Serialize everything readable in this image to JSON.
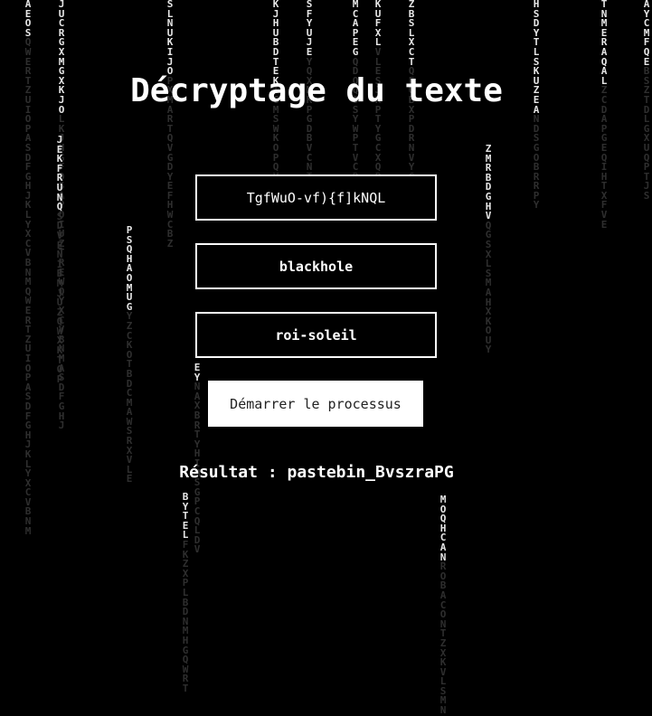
{
  "page": {
    "title": "Décryptage du texte"
  },
  "form": {
    "ciphertext_value": "TgfWuO-vf){f]kNQL",
    "key_value": "blackhole",
    "key2_value": "roi-soleil",
    "start_label": "Démarrer le processus"
  },
  "result": {
    "text": "Résultat : pastebin_BvszraPG"
  },
  "colors": {
    "background": "#000000",
    "foreground": "#ffffff",
    "rain_bright": "#e6e6e6",
    "rain_dim": "#2e2e2e"
  },
  "background_rain": {
    "columns": [
      {
        "bright": "AEOS",
        "dim": "QWERTZUIOPASDFGHJKLYXCVBNMQWERTZUIOPASDFGHJKLYXCVBNM"
      },
      {
        "bright": "JUCRGXMGXKJO",
        "dim": "LKJHGFDSAPOIUZTREWQYXCVBNMASDFGHJ"
      },
      {
        "bright": "JEKFRUNQ",
        "dim": "SDVENIBMJUZQWXKTOP"
      },
      {
        "bright": "PSQHAOMUG",
        "dim": "YZCKOTBDCMAWSRXVLE"
      },
      {
        "bright": "SLNUKIJO",
        "dim": "PXMARTQVGDYEFHWCBZ"
      },
      {
        "bright": "BYTEL",
        "dim": "FKZXPLBDNMHGQWRT"
      },
      {
        "bright": "EY",
        "dim": "NAXBRTYHIMSGPCQLDV"
      },
      {
        "bright": "KJHUBDTEK",
        "dim": "IGMSWKOPQVXZ"
      },
      {
        "bright": "SFYUJE",
        "dim": "YQXMKPGDBVCNTHLR"
      },
      {
        "bright": "MCAPEG",
        "dim": "QDOQOSYWPTVCRZ"
      },
      {
        "bright": "KUFXL",
        "dim": "VLESJKPTYGCXQBN"
      },
      {
        "bright": "ZBSLXCT",
        "dim": "QFUBXPDRNVYGTCAE"
      },
      {
        "bright": "MOQHCAN",
        "dim": "ROBACONTZXKVLSMN"
      },
      {
        "bright": "ZMRBDGHV",
        "dim": "QGSXLSMAHXKOUY"
      },
      {
        "bright": "HSDYTLSKUZEA",
        "dim": "NDSGOBRRPY"
      },
      {
        "bright": "TNMERAQAL",
        "dim": "ZCDAPGEQIHTXFVE"
      },
      {
        "bright": "AYCMFQE",
        "dim": "BSZTDLGXUQPTJS"
      }
    ]
  }
}
